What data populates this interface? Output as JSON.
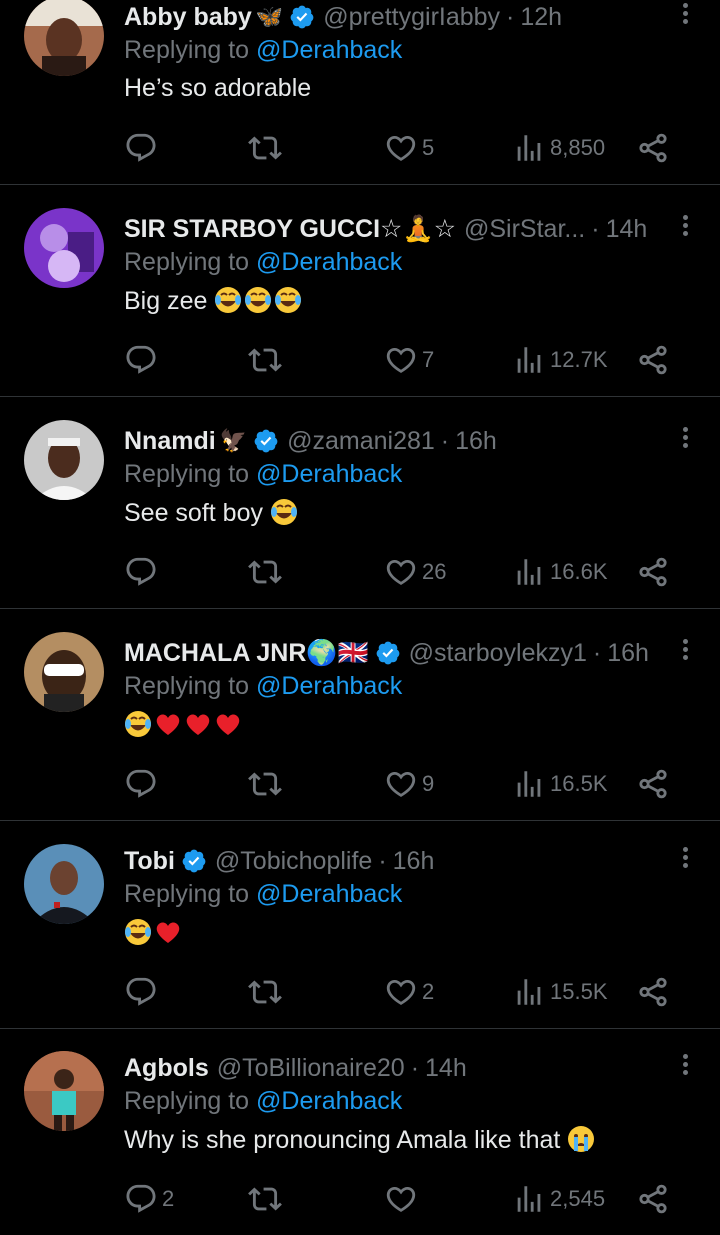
{
  "reply_prefix": "Replying to",
  "colors": {
    "background": "#000000",
    "text": "#e7e9ea",
    "muted": "#71767b",
    "link": "#1d9bf0",
    "divider": "#2f3336"
  },
  "tweets": [
    {
      "name": "Abby baby",
      "name_emoji": "🦋",
      "verified": true,
      "handle": "@prettygirIabby",
      "time": "12h",
      "reply_to": "@Derahback",
      "text": "He’s so adorable",
      "text_emojis": [],
      "replies": "",
      "likes": "5",
      "views": "8,850"
    },
    {
      "name": "SIR STARBOY GUCCI☆🧘☆",
      "name_emoji": "",
      "verified": false,
      "handle": "@SirStar...",
      "time": "14h",
      "reply_to": "@Derahback",
      "text": "Big zee",
      "text_emojis": [
        "joy",
        "joy",
        "joy"
      ],
      "replies": "",
      "likes": "7",
      "views": "12.7K"
    },
    {
      "name": "Nnamdi",
      "name_emoji": "🦅",
      "verified": true,
      "handle": "@zamani281",
      "time": "16h",
      "reply_to": "@Derahback",
      "text": "See soft boy",
      "text_emojis": [
        "joy"
      ],
      "replies": "",
      "likes": "26",
      "views": "16.6K"
    },
    {
      "name": "MACHALA JNR🌍🇬🇧",
      "name_emoji": "",
      "verified": true,
      "handle": "@starboylekzy1",
      "time": "16h",
      "reply_to": "@Derahback",
      "text": "",
      "text_emojis": [
        "joy",
        "heart",
        "heart",
        "heart"
      ],
      "replies": "",
      "likes": "9",
      "views": "16.5K"
    },
    {
      "name": "Tobi",
      "name_emoji": "",
      "verified": true,
      "handle": "@Tobichoplife",
      "time": "16h",
      "reply_to": "@Derahback",
      "text": "",
      "text_emojis": [
        "joy",
        "heart"
      ],
      "replies": "",
      "likes": "2",
      "views": "15.5K"
    },
    {
      "name": "Agbols",
      "name_emoji": "",
      "verified": false,
      "handle": "@ToBillionaire20",
      "time": "14h",
      "reply_to": "@Derahback",
      "text": "Why is she pronouncing Amala like that",
      "text_emojis": [
        "cry"
      ],
      "replies": "2",
      "likes": "",
      "views": "2,545"
    }
  ],
  "icons": {
    "reply": "reply-icon",
    "retweet": "retweet-icon",
    "like": "heart-icon",
    "views": "views-icon",
    "share": "share-icon",
    "more": "more-icon",
    "verified": "verified-badge-icon"
  }
}
